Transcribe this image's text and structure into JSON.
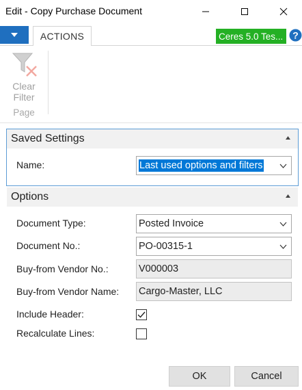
{
  "window": {
    "title": "Edit - Copy Purchase Document",
    "minimize_icon": "minimize-icon",
    "maximize_icon": "maximize-icon",
    "close_icon": "close-icon"
  },
  "ribbon": {
    "menu_icon": "caret-down-icon",
    "tabs": [
      {
        "label": "ACTIONS",
        "active": true
      }
    ],
    "company": {
      "label": "Ceres 5.0 Tes...",
      "color": "#24b024"
    },
    "help_icon": "help-icon",
    "group": {
      "label": "Page",
      "actions": [
        {
          "icon": "clear-filter-icon",
          "label_line1": "Clear",
          "label_line2": "Filter",
          "enabled": false
        }
      ]
    }
  },
  "saved_settings": {
    "header": "Saved Settings",
    "name_label": "Name:",
    "name_value": "Last used options and filters"
  },
  "options": {
    "header": "Options",
    "document_type_label": "Document Type:",
    "document_type_value": "Posted Invoice",
    "document_no_label": "Document No.:",
    "document_no_value": "PO-00315-1",
    "vendor_no_label": "Buy-from Vendor No.:",
    "vendor_no_value": "V000003",
    "vendor_name_label": "Buy-from Vendor Name:",
    "vendor_name_value": "Cargo-Master, LLC",
    "include_header_label": "Include Header:",
    "include_header_checked": true,
    "recalculate_lines_label": "Recalculate Lines:",
    "recalculate_lines_checked": false
  },
  "buttons": {
    "ok": "OK",
    "cancel": "Cancel"
  },
  "colors": {
    "accent_blue": "#1f6fbf",
    "focus_border": "#5b9bd5",
    "selection": "#0078d7"
  }
}
